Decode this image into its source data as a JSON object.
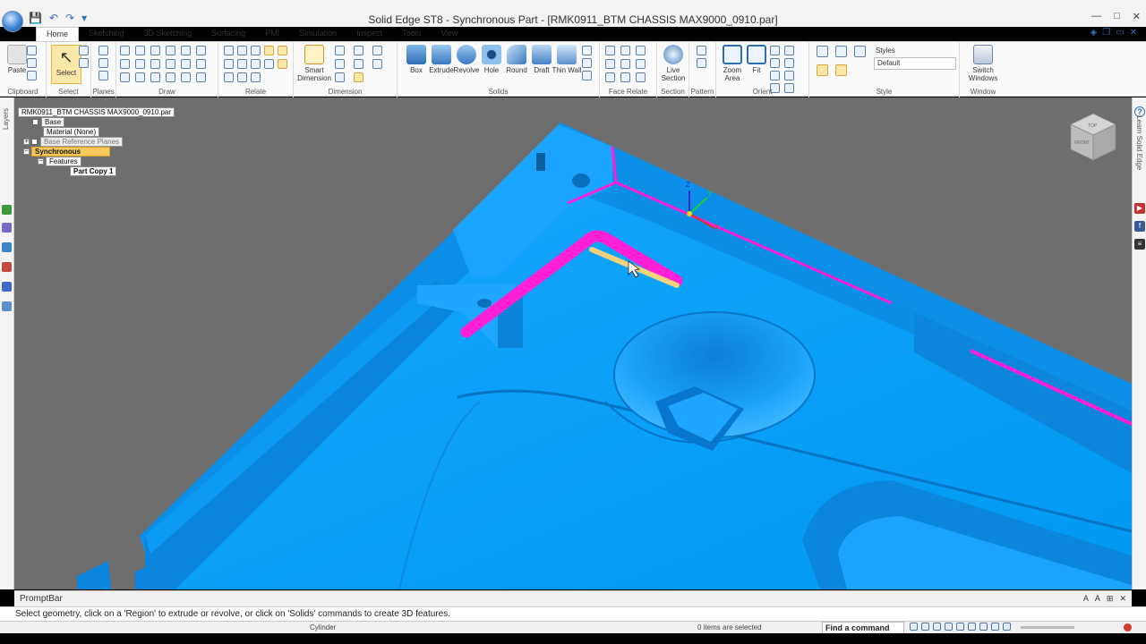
{
  "window": {
    "title": "Solid Edge ST8 - Synchronous Part - [RMK0911_BTM CHASSIS MAX9000_0910.par]",
    "controls": [
      "—",
      "□",
      "✕"
    ]
  },
  "quick_access": [
    "💾",
    "↶",
    "↷",
    "▾"
  ],
  "tabs": [
    "Home",
    "Sketching",
    "3D Sketching",
    "Surfacing",
    "PMI",
    "Simulation",
    "Inspect",
    "Tools",
    "View"
  ],
  "active_tab": "Home",
  "ribbon": {
    "clipboard": {
      "label": "Clipboard",
      "paste": "Paste"
    },
    "select": {
      "label": "Select",
      "select_btn": "Select"
    },
    "planes": {
      "label": "Planes"
    },
    "draw": {
      "label": "Draw"
    },
    "relate": {
      "label": "Relate"
    },
    "dimension": {
      "label": "Dimension",
      "smart_dimension": "Smart Dimension"
    },
    "solids": {
      "label": "Solids",
      "buttons": [
        "Box",
        "Extrude",
        "Revolve",
        "Hole",
        "Round",
        "Draft",
        "Thin Wall"
      ]
    },
    "face_relate": {
      "label": "Face Relate"
    },
    "section": {
      "label": "Section",
      "live_section": "Live Section"
    },
    "pattern": {
      "label": "Pattern"
    },
    "orient": {
      "label": "Orient",
      "zoom_area": "Zoom Area",
      "fit": "Fit"
    },
    "style": {
      "label": "Style",
      "styles": "Styles",
      "value": "Default"
    },
    "window": {
      "label": "Window",
      "switch_windows": "Switch Windows"
    }
  },
  "left_panel": {
    "layers": "Layers"
  },
  "right_panel": {
    "learn": "Learn Solid Edge"
  },
  "tree": {
    "root": "RMK0911_BTM CHASSIS MAX9000_0910.par",
    "base": "Base",
    "material": "Material (None)",
    "ref_planes": "Base Reference Planes",
    "synchronous": "Synchronous",
    "features": "Features",
    "part_copy": "Part Copy 1"
  },
  "viewcube": {
    "face_top": "TOP",
    "face_front": "FRONT"
  },
  "triad": {
    "x": "X",
    "y": "Y",
    "z": "Z"
  },
  "prompt_bar": {
    "title": "PromptBar",
    "message": "Select geometry, click on a 'Region' to extrude or revolve, or click on 'Solids' commands to create 3D features."
  },
  "status": {
    "hover": "Cylinder",
    "selected": "0 items are selected",
    "find": "Find a command"
  },
  "colors": {
    "part": "#00a2ff",
    "part_dark": "#0074c8",
    "highlight_edge": "#ff1fd6",
    "selected_edge": "#f2d27a",
    "viewport_bg": "#6e6e6e"
  }
}
